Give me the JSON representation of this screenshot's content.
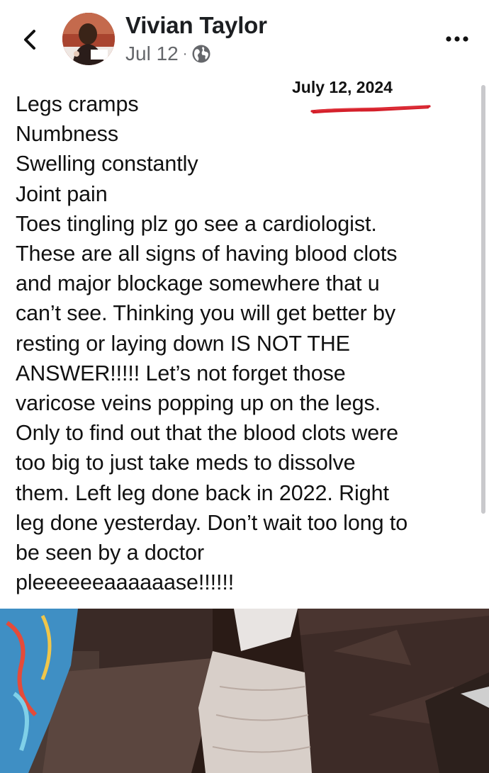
{
  "post": {
    "author": "Vivian Taylor",
    "date": "Jul 12",
    "separator": "·",
    "privacy_icon": "globe-icon",
    "back_icon": "chevron-left-icon",
    "more_icon": "more-horizontal-icon",
    "annotation_date": "July 12, 2024",
    "annotation_color": "#d41f2a",
    "body": "Legs cramps\nNumbness\nSwelling constantly\nJoint pain\nToes tingling plz go see a cardiologist.\nThese are all signs of having blood clots\nand major blockage somewhere that u\ncan’t see. Thinking you will get better by\nresting or laying down IS NOT THE\nANSWER!!!!! Let’s not forget those\nvaricose veins popping up on the legs.\nOnly to find out that the blood clots were\ntoo big to just take meds to dissolve\nthem. Left leg done back in 2022. Right\nleg done yesterday. Don’t wait too long to\nbe seen by a doctor\npleeeeeeaaaaaase!!!!!!"
  },
  "colors": {
    "name": "#1c1e21",
    "meta": "#65676b",
    "text": "#111111"
  }
}
